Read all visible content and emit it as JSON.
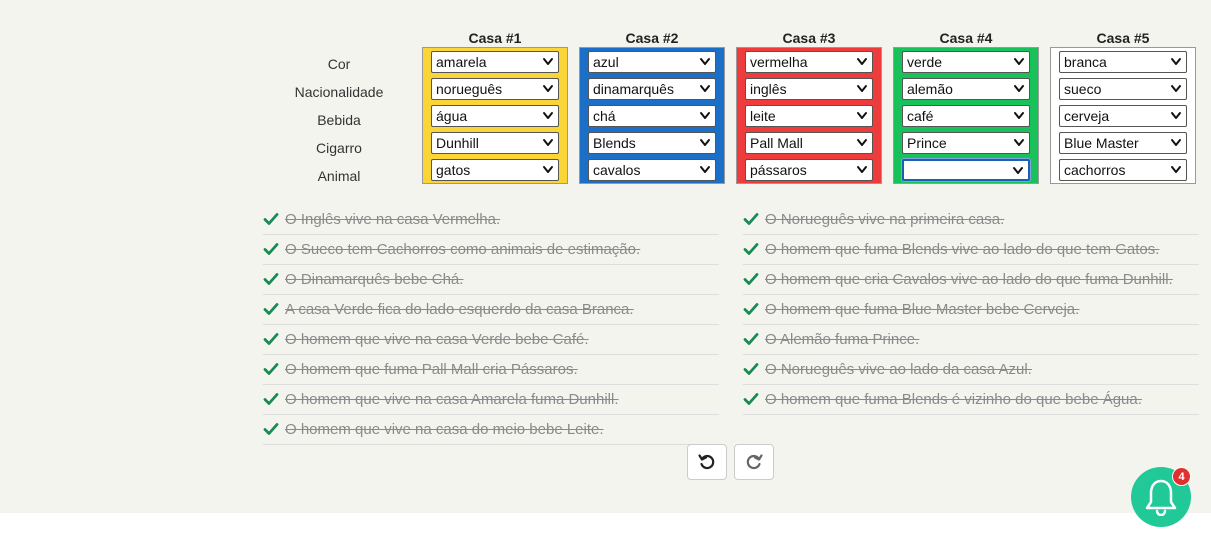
{
  "row_labels": [
    "Cor",
    "Nacionalidade",
    "Bebida",
    "Cigarro",
    "Animal"
  ],
  "houses": [
    {
      "title": "Casa #1",
      "color": "#f9d537",
      "values": [
        "amarela",
        "norueguês",
        "água",
        "Dunhill",
        "gatos"
      ]
    },
    {
      "title": "Casa #2",
      "color": "#1c6fc7",
      "values": [
        "azul",
        "dinamarquês",
        "chá",
        "Blends",
        "cavalos"
      ]
    },
    {
      "title": "Casa #3",
      "color": "#ee3b3b",
      "values": [
        "vermelha",
        "inglês",
        "leite",
        "Pall Mall",
        "pássaros"
      ]
    },
    {
      "title": "Casa #4",
      "color": "#19c15b",
      "values": [
        "verde",
        "alemão",
        "café",
        "Prince",
        ""
      ]
    },
    {
      "title": "Casa #5",
      "color": "#ffffff",
      "values": [
        "branca",
        "sueco",
        "cerveja",
        "Blue Master",
        "cachorros"
      ]
    }
  ],
  "clues_left": [
    "O Inglês vive na casa Vermelha.",
    "O Sueco tem Cachorros como animais de estimação.",
    "O Dinamarquês bebe Chá.",
    "A casa Verde fica do lado esquerdo da casa Branca.",
    "O homem que vive na casa Verde bebe Café.",
    "O homem que fuma Pall Mall cria Pássaros.",
    "O homem que vive na casa Amarela fuma Dunhill.",
    "O homem que vive na casa do meio bebe Leite."
  ],
  "clues_right": [
    "O Norueguês vive na primeira casa.",
    "O homem que fuma Blends vive ao lado do que tem Gatos.",
    "O homem que cria Cavalos vive ao lado do que fuma Dunhill.",
    "O homem que fuma Blue Master bebe Cerveja.",
    "O Alemão fuma Prince.",
    "O Norueguês vive ao lado da casa Azul.",
    "O homem que fuma Blends é vizinho do que bebe Água."
  ],
  "notification_count": "4",
  "colors": {
    "check": "#1a8a55",
    "bell": "#20c997",
    "badge": "#e03131",
    "focus": "#1a5fb4"
  },
  "icons": {
    "undo": "undo-icon",
    "redo": "redo-icon",
    "bell": "bell-icon",
    "check": "check-icon"
  }
}
